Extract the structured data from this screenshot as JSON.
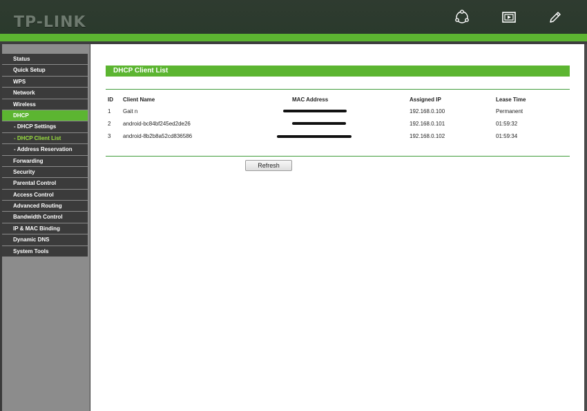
{
  "brand": {
    "logo_text": "TP-LINK"
  },
  "header_icons": [
    "share-icon",
    "slideshow-icon",
    "pencil-icon"
  ],
  "colors": {
    "accent": "#5cb531",
    "menu_bg": "#3b3b3b",
    "active_sub_text": "#9be13f",
    "header_bg": "#2f3b30"
  },
  "sidebar": {
    "items": [
      {
        "label": "Status"
      },
      {
        "label": "Quick Setup"
      },
      {
        "label": "WPS"
      },
      {
        "label": "Network"
      },
      {
        "label": "Wireless"
      },
      {
        "label": "DHCP"
      },
      {
        "label": "- DHCP Settings"
      },
      {
        "label": "- DHCP Client List"
      },
      {
        "label": "- Address Reservation"
      },
      {
        "label": "Forwarding"
      },
      {
        "label": "Security"
      },
      {
        "label": "Parental Control"
      },
      {
        "label": "Access Control"
      },
      {
        "label": "Advanced Routing"
      },
      {
        "label": "Bandwidth Control"
      },
      {
        "label": "IP & MAC Binding"
      },
      {
        "label": "Dynamic DNS"
      },
      {
        "label": "System Tools"
      }
    ]
  },
  "main": {
    "title": "DHCP Client List",
    "table": {
      "headers": [
        "ID",
        "Client Name",
        "MAC Address",
        "Assigned IP",
        "Lease Time"
      ],
      "rows": [
        {
          "id": "1",
          "name": "Gait n",
          "ip": "192.168.0.100",
          "lease": "Permanent"
        },
        {
          "id": "2",
          "name": "android-bc84bf245ed2de26",
          "ip": "192.168.0.101",
          "lease": "01:59:32"
        },
        {
          "id": "3",
          "name": "android-8b2b8a52cd836586",
          "ip": "192.168.0.102",
          "lease": "01:59:34"
        }
      ]
    },
    "refresh_label": "Refresh"
  }
}
